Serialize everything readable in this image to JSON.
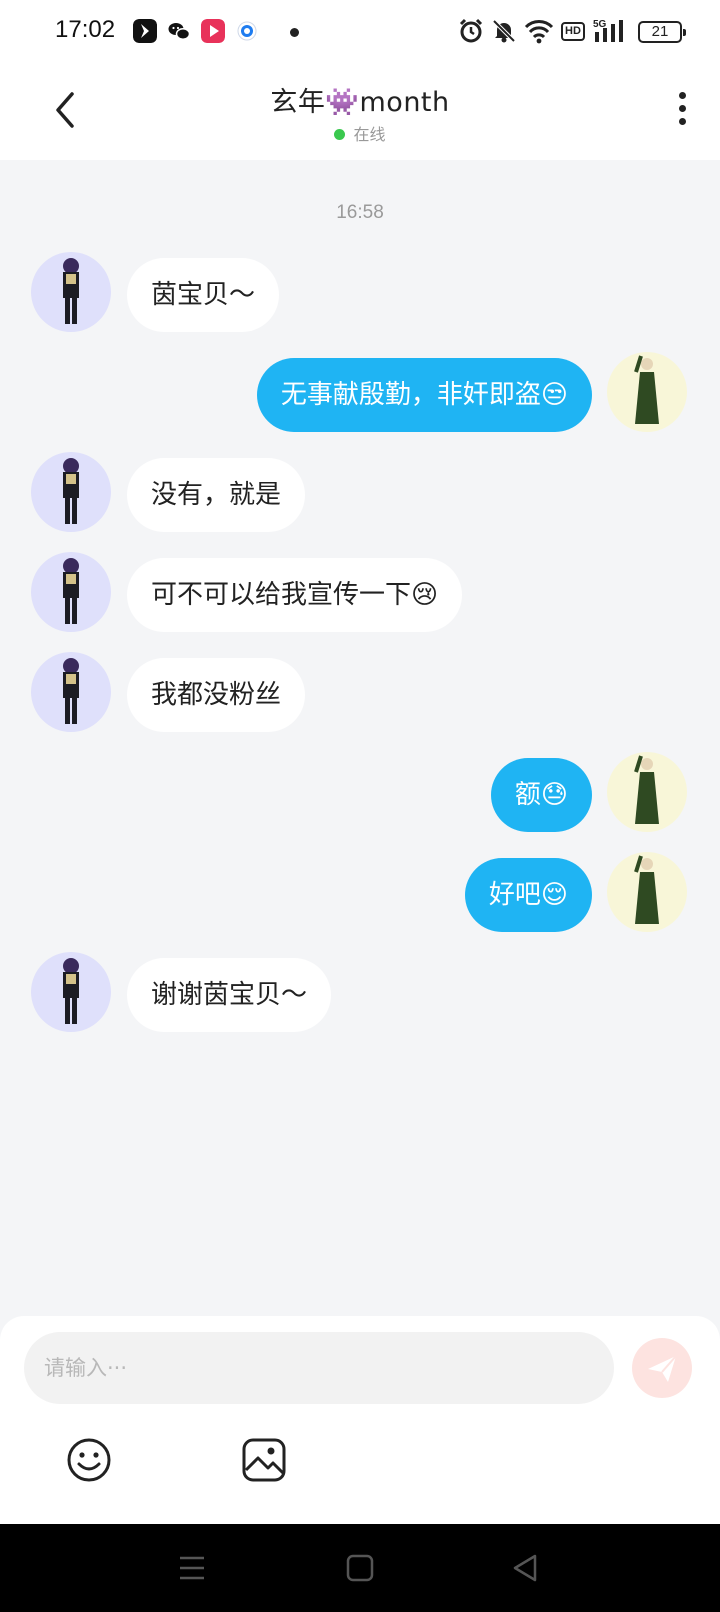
{
  "status_bar": {
    "time": "17:02",
    "battery": "21",
    "network_label": "HD",
    "apps": [
      "vpn-app-icon",
      "wechat-icon",
      "video-app-icon",
      "browser-app-icon"
    ],
    "right_icons": [
      "alarm-icon",
      "mute-icon",
      "wifi-icon",
      "5g-signal-icon",
      "battery-icon"
    ]
  },
  "header": {
    "title": "玄年👾month",
    "status": "在线",
    "status_color": "#3ac84e"
  },
  "chat": {
    "timestamp": "16:58",
    "messages": [
      {
        "side": "other",
        "text": "茵宝贝～"
      },
      {
        "side": "self",
        "text": "无事献殷勤，非奸即盗😒"
      },
      {
        "side": "other",
        "text": "没有，就是"
      },
      {
        "side": "other",
        "text": "可不可以给我宣传一下😢"
      },
      {
        "side": "other",
        "text": "我都没粉丝"
      },
      {
        "side": "self",
        "text": "额😓"
      },
      {
        "side": "self",
        "text": "好吧😌"
      },
      {
        "side": "other",
        "text": "谢谢茵宝贝～"
      }
    ]
  },
  "input": {
    "placeholder": "请输入···",
    "value": ""
  },
  "toolbar": {
    "emoji_icon": "emoji-icon",
    "image_icon": "image-icon",
    "send_icon": "send-icon"
  },
  "colors": {
    "self_bubble": "#1fb4f3",
    "other_bubble": "#ffffff",
    "background": "#f4f5f7",
    "send_button": "#fde3e0"
  }
}
